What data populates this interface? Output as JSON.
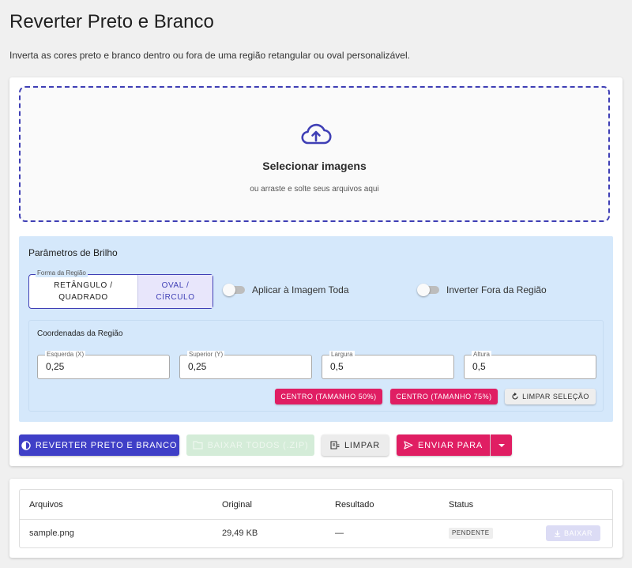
{
  "page": {
    "title": "Reverter Preto e Branco",
    "description": "Inverta as cores preto e branco dentro ou fora de uma região retangular ou oval personalizável."
  },
  "dropzone": {
    "title": "Selecionar imagens",
    "subtitle": "ou arraste e solte seus arquivos aqui",
    "icon": "cloud-upload-icon"
  },
  "params": {
    "title": "Parâmetros de Brilho",
    "shape": {
      "legend": "Forma da Região",
      "options": [
        "RETÂNGULO / QUADRADO",
        "OVAL / CÍRCULO"
      ],
      "selected": "OVAL / CÍRCULO"
    },
    "apply_whole": {
      "label": "Aplicar à Imagem Toda",
      "checked": false
    },
    "invert_outside": {
      "label": "Inverter Fora da Região",
      "checked": false
    },
    "coords": {
      "title": "Coordenadas da Região",
      "fields": [
        {
          "label": "Esquerda (X)",
          "value": "0,25"
        },
        {
          "label": "Superior (Y)",
          "value": "0,25"
        },
        {
          "label": "Largura",
          "value": "0,5"
        },
        {
          "label": "Altura",
          "value": "0,5"
        }
      ],
      "center50_label": "CENTRO (TAMANHO 50%)",
      "center75_label": "CENTRO (TAMANHO 75%)",
      "clear_selection_label": "LIMPAR SELEÇÃO"
    }
  },
  "actions": {
    "invert_label": "REVERTER PRETO E BRANCO",
    "download_all_label": "BAIXAR TODOS (.ZIP)",
    "clear_label": "LIMPAR",
    "send_label": "ENVIAR PARA"
  },
  "files": {
    "columns": [
      "Arquivos",
      "Original",
      "Resultado",
      "Status"
    ],
    "rows": [
      {
        "name": "sample.png",
        "original": "29,49 KB",
        "result": "—",
        "status": "PENDENTE",
        "download_label": "BAIXAR"
      }
    ]
  },
  "colors": {
    "primary": "#3f3fc7",
    "accent": "#e01e63",
    "params_bg": "#d5e8fb",
    "success_disabled": "#d4ecd8"
  }
}
